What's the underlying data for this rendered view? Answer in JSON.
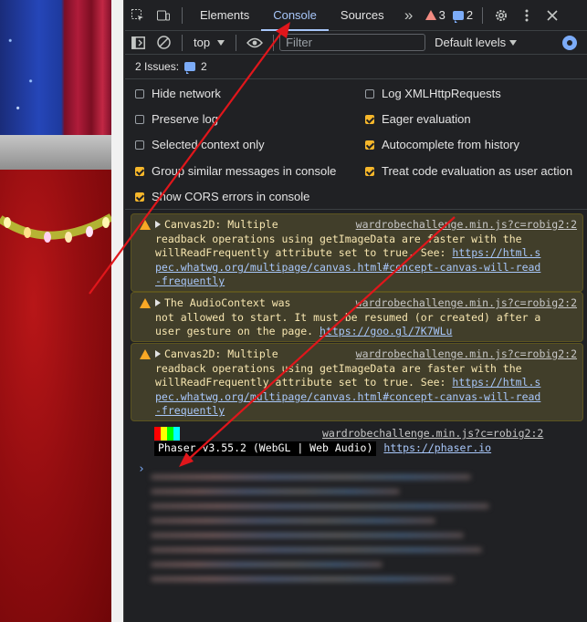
{
  "devtools": {
    "tabs": [
      "Elements",
      "Console",
      "Sources"
    ],
    "active_tab": "Console",
    "more_tabs": "»",
    "warning_count": "3",
    "message_count": "2"
  },
  "filterbar": {
    "context": "top",
    "filter_placeholder": "Filter",
    "levels": "Default levels"
  },
  "issues": {
    "label": "2 Issues:",
    "count": "2"
  },
  "settings": {
    "left": [
      {
        "label": "Hide network",
        "checked": false
      },
      {
        "label": "Preserve log",
        "checked": false
      },
      {
        "label": "Selected context only",
        "checked": false
      },
      {
        "label": "Group similar messages in console",
        "checked": true
      },
      {
        "label": "Show CORS errors in console",
        "checked": true
      }
    ],
    "right": [
      {
        "label": "Log XMLHttpRequests",
        "checked": false
      },
      {
        "label": "Eager evaluation",
        "checked": true
      },
      {
        "label": "Autocomplete from history",
        "checked": true
      },
      {
        "label": "Treat code evaluation as user action",
        "checked": true
      }
    ]
  },
  "messages": [
    {
      "source": "wardrobechallenge.min.js?c=robig2:2",
      "lines": [
        "Canvas2D: Multiple",
        "readback operations using getImageData are faster with the",
        "willReadFrequently attribute set to true. See: "
      ],
      "link": "https://html.spec.whatwg.org/multipage/canvas.html#concept-canvas-will-read-frequently",
      "link_lines": [
        "https://html.s",
        "pec.whatwg.org/multipage/canvas.html#concept-canvas-will-read",
        "-frequently"
      ]
    },
    {
      "source": "wardrobechallenge.min.js?c=robig2:2",
      "lines": [
        "The AudioContext was",
        "not allowed to start. It must be resumed (or created) after a",
        "user gesture on the page. "
      ],
      "link": "https://goo.gl/7K7WLu",
      "link_lines": [
        "https://goo.gl/7K7WLu"
      ]
    },
    {
      "source": "wardrobechallenge.min.js?c=robig2:2",
      "lines": [
        "Canvas2D: Multiple",
        "readback operations using getImageData are faster with the",
        "willReadFrequently attribute set to true. See: "
      ],
      "link": "https://html.spec.whatwg.org/multipage/canvas.html#concept-canvas-will-read-frequently",
      "link_lines": [
        "https://html.s",
        "pec.whatwg.org/multipage/canvas.html#concept-canvas-will-read",
        "-frequently"
      ]
    }
  ],
  "phaser": {
    "source": "wardrobechallenge.min.js?c=robig2:2",
    "tag": "Phaser v3.55.2 (WebGL | Web Audio)",
    "link": "https://phaser.io",
    "bar_colors": [
      "#ff0000",
      "#ffff00",
      "#00ff00",
      "#00ffff"
    ]
  },
  "prompt": "›",
  "annotation_color": "#e0161b"
}
